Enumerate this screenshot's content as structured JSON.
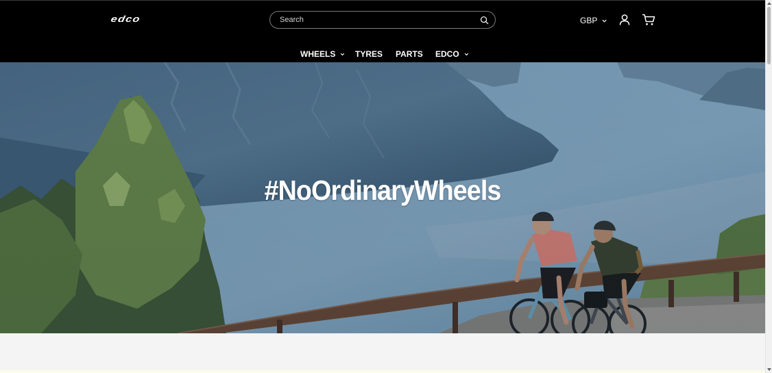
{
  "header": {
    "logo_text": "edco",
    "search": {
      "placeholder": "Search",
      "value": ""
    },
    "currency": "GBP",
    "icons": {
      "search": "search-icon",
      "account": "user-icon",
      "cart": "cart-icon"
    }
  },
  "nav": {
    "items": [
      {
        "label": "WHEELS",
        "has_dropdown": true
      },
      {
        "label": "TYRES",
        "has_dropdown": false
      },
      {
        "label": "PARTS",
        "has_dropdown": false
      },
      {
        "label": "EDCO",
        "has_dropdown": true
      }
    ]
  },
  "hero": {
    "headline": "#NoOrdinaryWheels"
  },
  "colors": {
    "header_bg": "#000000",
    "text": "#ffffff",
    "band_bg": "#f4f4f4"
  }
}
